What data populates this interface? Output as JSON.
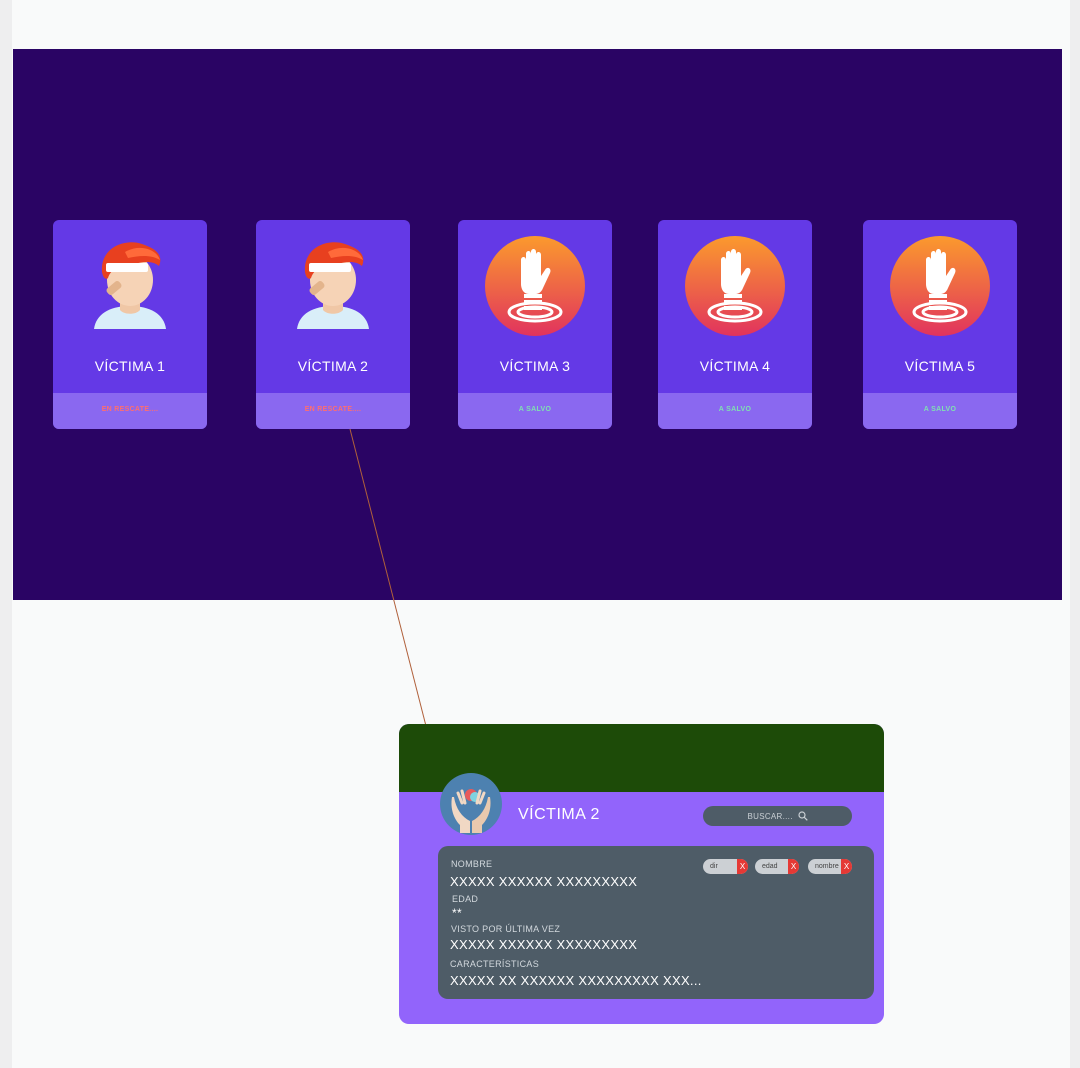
{
  "victims": [
    {
      "name": "VÍCTIMA 1",
      "status": "EN RESCATE....",
      "status_color": "#ff6e6e",
      "icon": "injured-person-icon"
    },
    {
      "name": "VÍCTIMA 2",
      "status": "EN RESCATE....",
      "status_color": "#ff6e6e",
      "icon": "injured-person-icon"
    },
    {
      "name": "VÍCTIMA 3",
      "status": "A SALVO",
      "status_color": "#7fe0b2",
      "icon": "sinking-hand-icon"
    },
    {
      "name": "VÍCTIMA 4",
      "status": "A SALVO",
      "status_color": "#7fe0b2",
      "icon": "sinking-hand-icon"
    },
    {
      "name": "VÍCTIMA 5",
      "status": "A SALVO",
      "status_color": "#7fe0b2",
      "icon": "sinking-hand-icon"
    }
  ],
  "detail": {
    "title": "VÍCTIMA 2",
    "search_placeholder": "BUSCAR....",
    "filters": [
      {
        "label": "dir",
        "remove": "X"
      },
      {
        "label": "edad",
        "remove": "X"
      },
      {
        "label": "nombre",
        "remove": "X"
      }
    ],
    "fields": {
      "name_label": "NOMBRE",
      "name_value": "XXXXX XXXXXX XXXXXXXXX",
      "age_label": "EDAD",
      "age_value": "**",
      "last_seen_label": "VISTO POR ÚLTIMA VEZ",
      "last_seen_value": "XXXXX XXXXXX XXXXXXXXX",
      "features_label": "CARACTERÍSTICAS",
      "features_value": "XXXXX XX XXXXXX XXXXXXXXX XXX..."
    }
  },
  "colors": {
    "panel_bg": "#2a0464",
    "card_bg": "#6439e6",
    "detail_header": "#1d4b08",
    "detail_body": "#9264fb",
    "info_bg": "#4e5c67",
    "connector": "#b0603a"
  }
}
